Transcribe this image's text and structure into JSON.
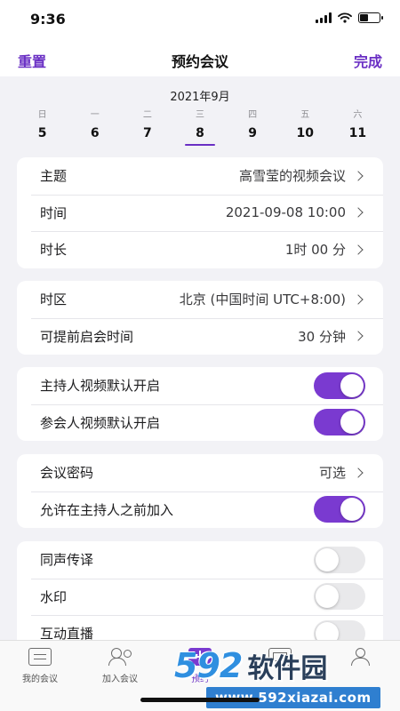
{
  "status_bar": {
    "time": "9:36"
  },
  "nav": {
    "reset_label": "重置",
    "title": "预约会议",
    "done_label": "完成"
  },
  "calendar": {
    "month": "2021年9月",
    "days": [
      {
        "weekday": "日",
        "date": "5"
      },
      {
        "weekday": "一",
        "date": "6"
      },
      {
        "weekday": "二",
        "date": "7"
      },
      {
        "weekday": "三",
        "date": "8",
        "selected": true
      },
      {
        "weekday": "四",
        "date": "9"
      },
      {
        "weekday": "五",
        "date": "10"
      },
      {
        "weekday": "六",
        "date": "11"
      }
    ]
  },
  "section1": {
    "topic": {
      "label": "主题",
      "value": "高雪莹的视频会议"
    },
    "time": {
      "label": "时间",
      "value": "2021-09-08 10:00"
    },
    "duration": {
      "label": "时长",
      "value": "1时 00 分"
    }
  },
  "section2": {
    "timezone": {
      "label": "时区",
      "value": "北京 (中国时间 UTC+8:00)"
    },
    "early_start": {
      "label": "可提前启会时间",
      "value": "30 分钟"
    }
  },
  "section3": {
    "host_video": {
      "label": "主持人视频默认开启",
      "on": true
    },
    "participant_video": {
      "label": "参会人视频默认开启",
      "on": true
    }
  },
  "section4": {
    "password": {
      "label": "会议密码",
      "value": "可选"
    },
    "join_before_host": {
      "label": "允许在主持人之前加入",
      "on": true
    }
  },
  "section5": {
    "interpretation": {
      "label": "同声传译",
      "on": false
    },
    "watermark": {
      "label": "水印",
      "on": false
    },
    "live_stream": {
      "label": "互动直播",
      "on": false
    }
  },
  "tab_bar": {
    "tabs": [
      {
        "label": "我的会议",
        "icon": "meeting-list-icon"
      },
      {
        "label": "加入会议",
        "icon": "join-people-icon"
      },
      {
        "label": "预约",
        "icon": "schedule-plus-icon",
        "active": true
      }
    ]
  },
  "overlay_watermark": {
    "number": "592",
    "text": "软件园",
    "url": "www.592xiazai.com"
  },
  "colors": {
    "accent": "#7a3ad0",
    "accent_text": "#6a2fc4",
    "background": "#f2f2f6"
  }
}
